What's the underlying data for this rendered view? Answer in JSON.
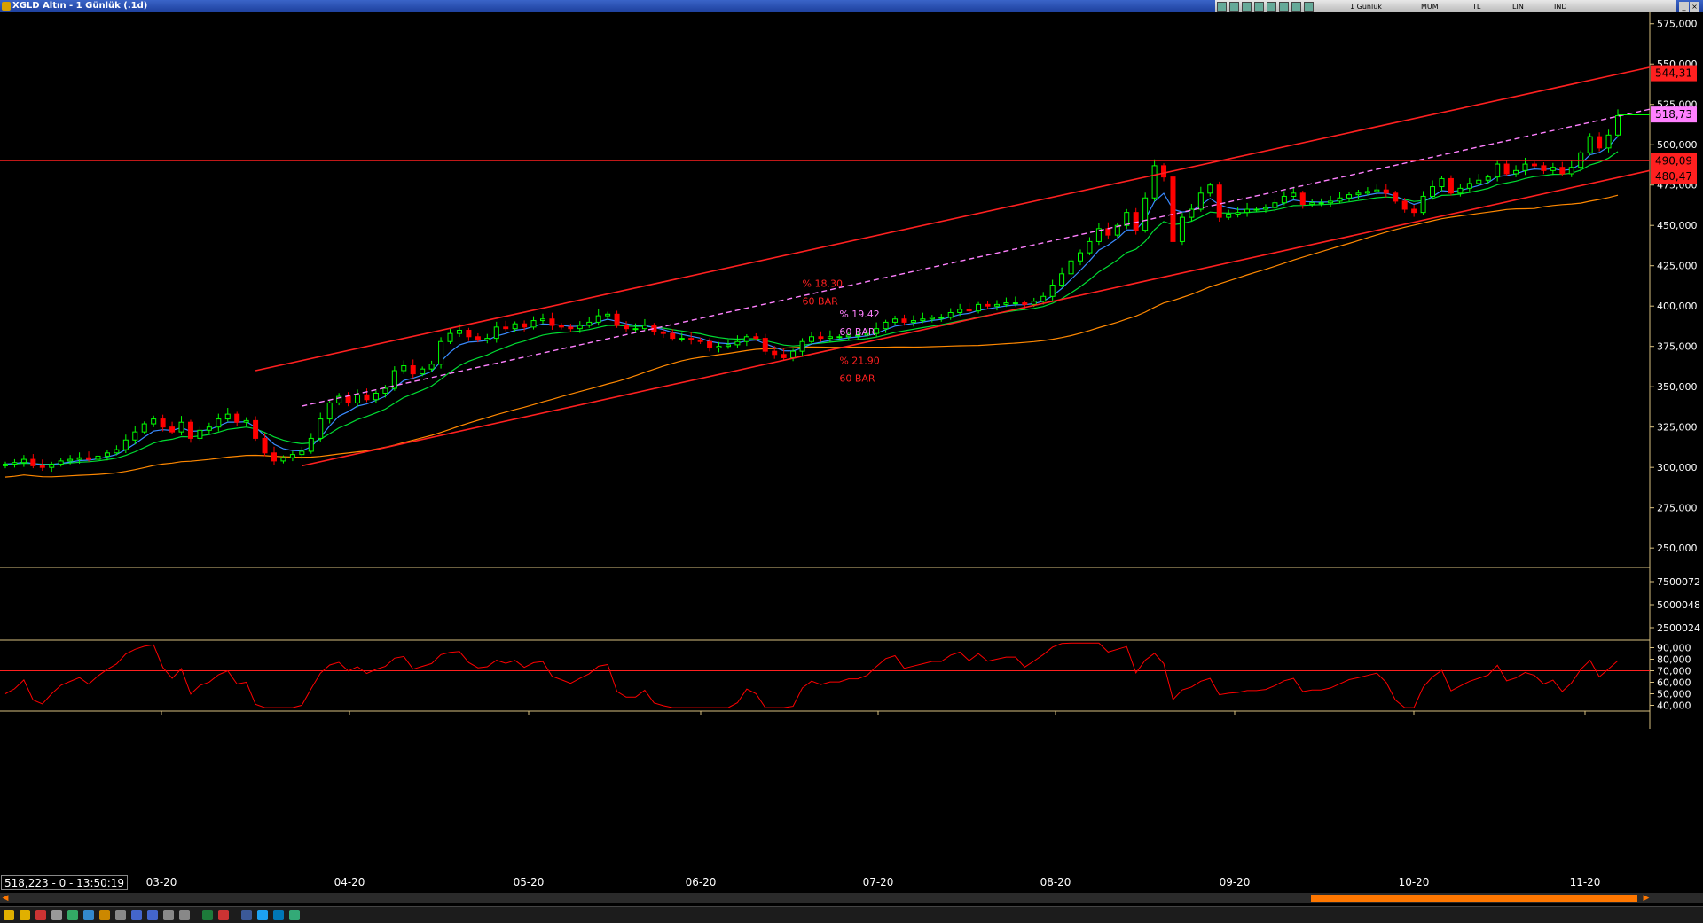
{
  "window": {
    "title": "XGLD  Altın - 1 Günlük (.1d)",
    "toolbar": {
      "period": "1 Günlük",
      "chart_mode": "MUM",
      "currency": "TL",
      "scale": "LIN",
      "indicators": "IND"
    }
  },
  "status": {
    "readout": "518,223 - 0 - 13:50:19"
  },
  "colors": {
    "bull": "#00ff00",
    "bear": "#ff0000",
    "ma_fast": "#3a8bff",
    "ma_mid": "#00dd33",
    "ma_slow": "#ff8800",
    "channel": "#ff2020",
    "regression": "#ff80ff"
  },
  "chart_data": {
    "type": "candlestick",
    "x_labels": [
      "03-20",
      "04-20",
      "05-20",
      "06-20",
      "07-20",
      "08-20",
      "09-20",
      "10-20",
      "11-20"
    ],
    "y_ticks": [
      "575,000",
      "550,000",
      "525,000",
      "500,000",
      "475,000",
      "450,000",
      "425,000",
      "400,000",
      "375,000",
      "350,000",
      "325,000",
      "300,000",
      "275,000",
      "250,000"
    ],
    "ylim": [
      238,
      582
    ],
    "price_labels": [
      {
        "text": "544,31",
        "value": 544.31,
        "kind": "channel"
      },
      {
        "text": "518,73",
        "value": 518.73,
        "kind": "regression"
      },
      {
        "text": "490,09",
        "value": 490.09,
        "kind": "level"
      },
      {
        "text": "480,47",
        "value": 480.47,
        "kind": "channel"
      }
    ],
    "horizontal_level": 490.09,
    "annotations": [
      {
        "line1": "% 18.30",
        "line2": "60 BAR",
        "kind": "channel"
      },
      {
        "line1": "% 19.42",
        "line2": "60 BAR",
        "kind": "regression"
      },
      {
        "line1": "% 21.90",
        "line2": "60 BAR",
        "kind": "channel"
      }
    ],
    "volume_panel": {
      "y_ticks": [
        "7500072",
        "5000048",
        "2500024"
      ]
    },
    "oscillator_panel": {
      "y_ticks": [
        "90,000",
        "80,000",
        "70,000",
        "60,000",
        "50,000",
        "40,000"
      ],
      "level": 70
    },
    "closes": [
      302,
      303,
      305,
      301,
      300,
      302,
      304,
      305,
      306,
      305,
      307,
      309,
      311,
      317,
      322,
      327,
      330,
      325,
      322,
      328,
      318,
      323,
      325,
      330,
      333,
      328,
      329,
      318,
      309,
      304,
      306,
      308,
      310,
      318,
      330,
      340,
      344,
      340,
      345,
      342,
      346,
      349,
      360,
      363,
      358,
      361,
      364,
      378,
      383,
      385,
      381,
      379,
      380,
      387,
      386,
      389,
      387,
      391,
      392,
      388,
      387,
      386,
      388,
      390,
      394,
      395,
      388,
      386,
      386,
      388,
      384,
      383,
      380,
      380,
      379,
      378,
      374,
      375,
      376,
      378,
      381,
      380,
      372,
      370,
      368,
      372,
      378,
      381,
      380,
      381,
      381,
      382,
      382,
      383,
      386,
      390,
      392,
      390,
      391,
      392,
      393,
      393,
      396,
      398,
      397,
      401,
      400,
      401,
      402,
      402,
      401,
      403,
      406,
      413,
      420,
      428,
      433,
      440,
      448,
      444,
      450,
      458,
      447,
      467,
      487,
      480,
      440,
      455,
      460,
      470,
      475,
      455,
      457,
      458,
      460,
      460,
      461,
      464,
      468,
      470,
      463,
      464,
      464,
      465,
      467,
      469,
      470,
      471,
      472,
      470,
      465,
      460,
      458,
      468,
      474,
      479,
      470,
      473,
      476,
      478,
      480,
      488,
      482,
      484,
      488,
      487,
      484,
      486,
      482,
      486,
      495,
      505,
      498,
      506,
      518
    ]
  }
}
